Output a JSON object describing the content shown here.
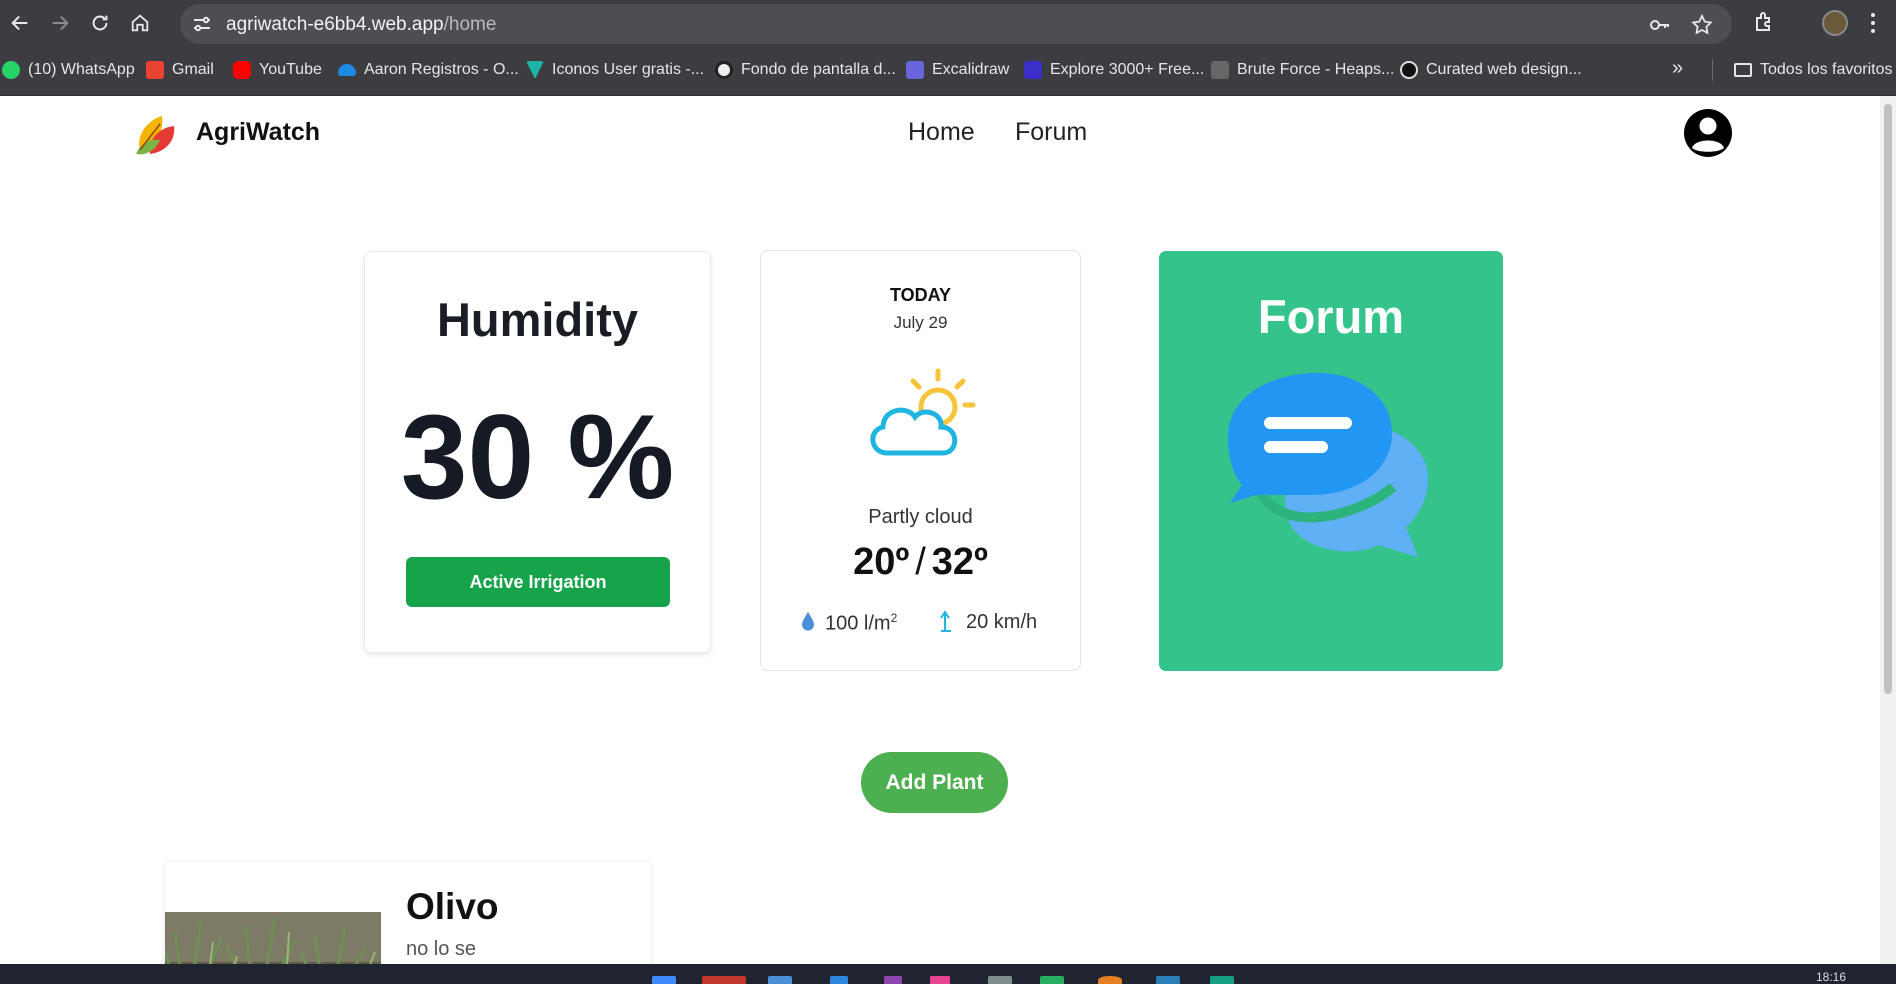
{
  "browser": {
    "url_host": "agriwatch-e6bb4.web.app",
    "url_path": "/home",
    "bookmarks": [
      {
        "label": "(10) WhatsApp",
        "icon": "whatsapp-icon",
        "color": "#25d366"
      },
      {
        "label": "Gmail",
        "icon": "gmail-icon",
        "color": "#ea4335"
      },
      {
        "label": "YouTube",
        "icon": "youtube-icon",
        "color": "#ff0000"
      },
      {
        "label": "Aaron Registros - O...",
        "icon": "onedrive-icon",
        "color": "#1e88e5"
      },
      {
        "label": "Iconos User gratis -...",
        "icon": "vuetify-icon",
        "color": "#1eb3a4"
      },
      {
        "label": "Fondo de pantalla d...",
        "icon": "site-icon",
        "color": "#222222"
      },
      {
        "label": "Excalidraw",
        "icon": "excalidraw-icon",
        "color": "#6965db"
      },
      {
        "label": "Explore 3000+ Free...",
        "icon": "uiverse-icon",
        "color": "#3b2fc9"
      },
      {
        "label": "Brute Force - Heaps...",
        "icon": "code-icon",
        "color": "#555555"
      },
      {
        "label": "Curated web design...",
        "icon": "eye-icon",
        "color": "#111111"
      }
    ],
    "all_bookmarks_label": "Todos los favoritos"
  },
  "nav": {
    "brand": "AgriWatch",
    "links": [
      "Home",
      "Forum"
    ]
  },
  "humidity": {
    "title": "Humidity",
    "value": "30 %",
    "button": "Active Irrigation"
  },
  "weather": {
    "day": "TODAY",
    "date": "July 29",
    "condition": "Partly cloud",
    "temp_low": "20º",
    "temp_high": "32º",
    "rain_amount": "100 l/m",
    "rain_exp": "2",
    "wind": "20 km/h"
  },
  "forum_card": {
    "title": "Forum"
  },
  "add_plant": "Add Plant",
  "plant": {
    "name": "Olivo",
    "description": "no lo se"
  },
  "taskbar": {
    "time": "18:16"
  },
  "colors": {
    "primary_green": "#16a34a",
    "forum_green": "#34c48b",
    "add_plant_green": "#4caf50",
    "chat_blue": "#2196f3"
  }
}
